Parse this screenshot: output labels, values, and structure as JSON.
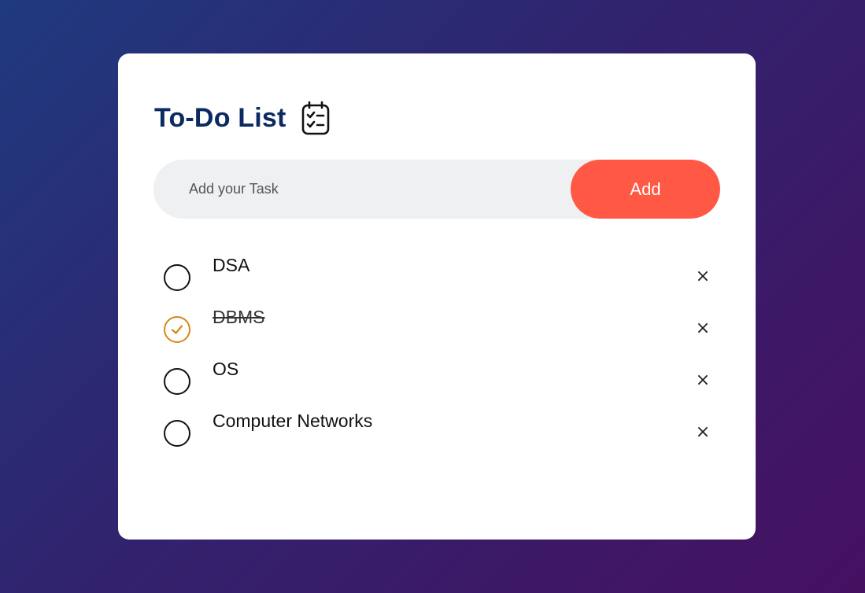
{
  "app": {
    "title": "To-Do List",
    "title_icon": "clipboard-checklist-icon"
  },
  "input": {
    "placeholder": "Add your Task",
    "value": "",
    "add_label": "Add"
  },
  "tasks": [
    {
      "label": "DSA",
      "done": false
    },
    {
      "label": "DBMS",
      "done": true
    },
    {
      "label": "OS",
      "done": false
    },
    {
      "label": "Computer Networks",
      "done": false
    }
  ],
  "icons": {
    "delete": "×",
    "delete_name": "close-icon",
    "check_name": "check-icon"
  },
  "colors": {
    "title": "#0c2a62",
    "accent": "#ff5945",
    "checked": "#d4881b",
    "input_bg": "#eef0f1"
  }
}
